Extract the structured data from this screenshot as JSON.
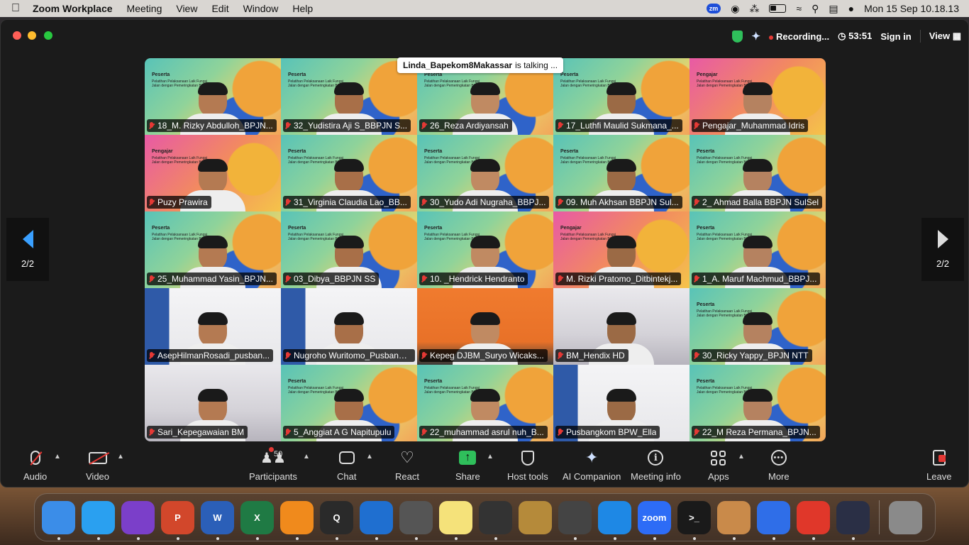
{
  "menubar": {
    "app_name": "Zoom Workplace",
    "items": [
      "Meeting",
      "View",
      "Edit",
      "Window",
      "Help"
    ],
    "zm_badge": "zm",
    "datetime": "Mon 15 Sep  10.18.13"
  },
  "window": {
    "recording_label": "Recording...",
    "timer": "53:51",
    "sign_in": "Sign in",
    "view": "View"
  },
  "talking": {
    "speaker": "Linda_Bapekom8Makassar",
    "suffix": "is talking ..."
  },
  "pagination": {
    "left": "2/2",
    "right": "2/2"
  },
  "slide_text": {
    "peserta": "Peserta",
    "pengajar": "Pengajar",
    "course": "Pelatihan Pelaksanaan Laik Fungsi Jalan dengan Pemeringkatan Bintang"
  },
  "participants": [
    {
      "name": "18_M. Rizky Abdulloh_BPJN...",
      "bg": "peserta"
    },
    {
      "name": "32_Yudistira Aji S_BBPJN S...",
      "bg": "peserta"
    },
    {
      "name": "26_Reza Ardiyansah",
      "bg": "peserta"
    },
    {
      "name": "17_Luthfi Maulid Sukmana_...",
      "bg": "peserta"
    },
    {
      "name": "Pengajar_Muhammad Idris",
      "bg": "pengajar"
    },
    {
      "name": "Puzy Prawira",
      "bg": "pengajar"
    },
    {
      "name": "31_Virginia Claudia Lao_BB...",
      "bg": "peserta"
    },
    {
      "name": "30_Yudo Adi Nugraha_BBPJ...",
      "bg": "peserta"
    },
    {
      "name": "09. Muh Akhsan BBPJN Sul...",
      "bg": "peserta"
    },
    {
      "name": "2_ Ahmad Balla BBPJN SulSel",
      "bg": "peserta"
    },
    {
      "name": "25_Muhammad Yasin_BPJN...",
      "bg": "peserta"
    },
    {
      "name": "03_Dibya_BBPJN SS",
      "bg": "peserta"
    },
    {
      "name": "10. _Hendrick Hendranto",
      "bg": "peserta"
    },
    {
      "name": "M. Rizki Pratomo_Ditbintekj...",
      "bg": "pengajar"
    },
    {
      "name": "1_A. Maruf Machmud_BBPJ...",
      "bg": "peserta"
    },
    {
      "name": "AsepHilmanRosadi_pusban...",
      "bg": "banner"
    },
    {
      "name": "Nugroho Wuritomo_Pusbangk...",
      "bg": "banner"
    },
    {
      "name": "Kepeg DJBM_Suryo Wicaks...",
      "bg": "orange"
    },
    {
      "name": "BM_Hendix HD",
      "bg": "office"
    },
    {
      "name": "30_Ricky Yappy_BPJN NTT",
      "bg": "peserta"
    },
    {
      "name": "Sari_Kepegawaian BM",
      "bg": "office"
    },
    {
      "name": "5_Anggiat A G Napitupulu",
      "bg": "peserta"
    },
    {
      "name": "22_muhammad asrul nuh_B...",
      "bg": "peserta"
    },
    {
      "name": "Pusbangkom BPW_Ella",
      "bg": "banner"
    },
    {
      "name": "22_M Reza Permana_BPJN...",
      "bg": "peserta"
    }
  ],
  "toolbar": {
    "audio": "Audio",
    "video": "Video",
    "participants": "Participants",
    "participant_count": "50",
    "chat": "Chat",
    "react": "React",
    "share": "Share",
    "host_tools": "Host tools",
    "ai_companion": "AI Companion",
    "meeting_info": "Meeting info",
    "apps": "Apps",
    "more": "More",
    "leave": "Leave"
  },
  "dock": [
    {
      "name": "finder-icon",
      "label": "",
      "color": "#3b8de8"
    },
    {
      "name": "safari-icon",
      "label": "",
      "color": "#2aa0f0"
    },
    {
      "name": "firefox-icon",
      "label": "",
      "color": "#7b3fc9"
    },
    {
      "name": "powerpoint-icon",
      "label": "P",
      "color": "#d2472b"
    },
    {
      "name": "word-icon",
      "label": "W",
      "color": "#2b5fb8"
    },
    {
      "name": "excel-icon",
      "label": "X",
      "color": "#1f7a44"
    },
    {
      "name": "vlc-icon",
      "label": "",
      "color": "#f08a1c"
    },
    {
      "name": "quicktime-icon",
      "label": "Q",
      "color": "#2a2a2a"
    },
    {
      "name": "wave-app-icon",
      "label": "",
      "color": "#1f6fd0"
    },
    {
      "name": "calculator-icon",
      "label": "",
      "color": "#555555"
    },
    {
      "name": "stickies-icon",
      "label": "",
      "color": "#f5e27a"
    },
    {
      "name": "photo-booth-icon",
      "label": "",
      "color": "#333333"
    },
    {
      "name": "archive-utility-icon",
      "label": "",
      "color": "#b58a3a"
    },
    {
      "name": "network-utility-icon",
      "label": "",
      "color": "#444444"
    },
    {
      "name": "vscode-icon",
      "label": "",
      "color": "#1e88e5"
    },
    {
      "name": "zoom-icon",
      "label": "zoom",
      "color": "#2d6cf6"
    },
    {
      "name": "terminal-icon",
      "label": ">_",
      "color": "#1a1a1a"
    },
    {
      "name": "color-palette-icon",
      "label": "",
      "color": "#c98a4a"
    },
    {
      "name": "roblox-icon",
      "label": "",
      "color": "#2f6ee8"
    },
    {
      "name": "pdf-reader-icon",
      "label": "",
      "color": "#e0372a"
    },
    {
      "name": "obs-icon",
      "label": "",
      "color": "#2a2f45"
    },
    {
      "name": "trash-icon",
      "label": "",
      "color": "#8a8a8a"
    }
  ]
}
